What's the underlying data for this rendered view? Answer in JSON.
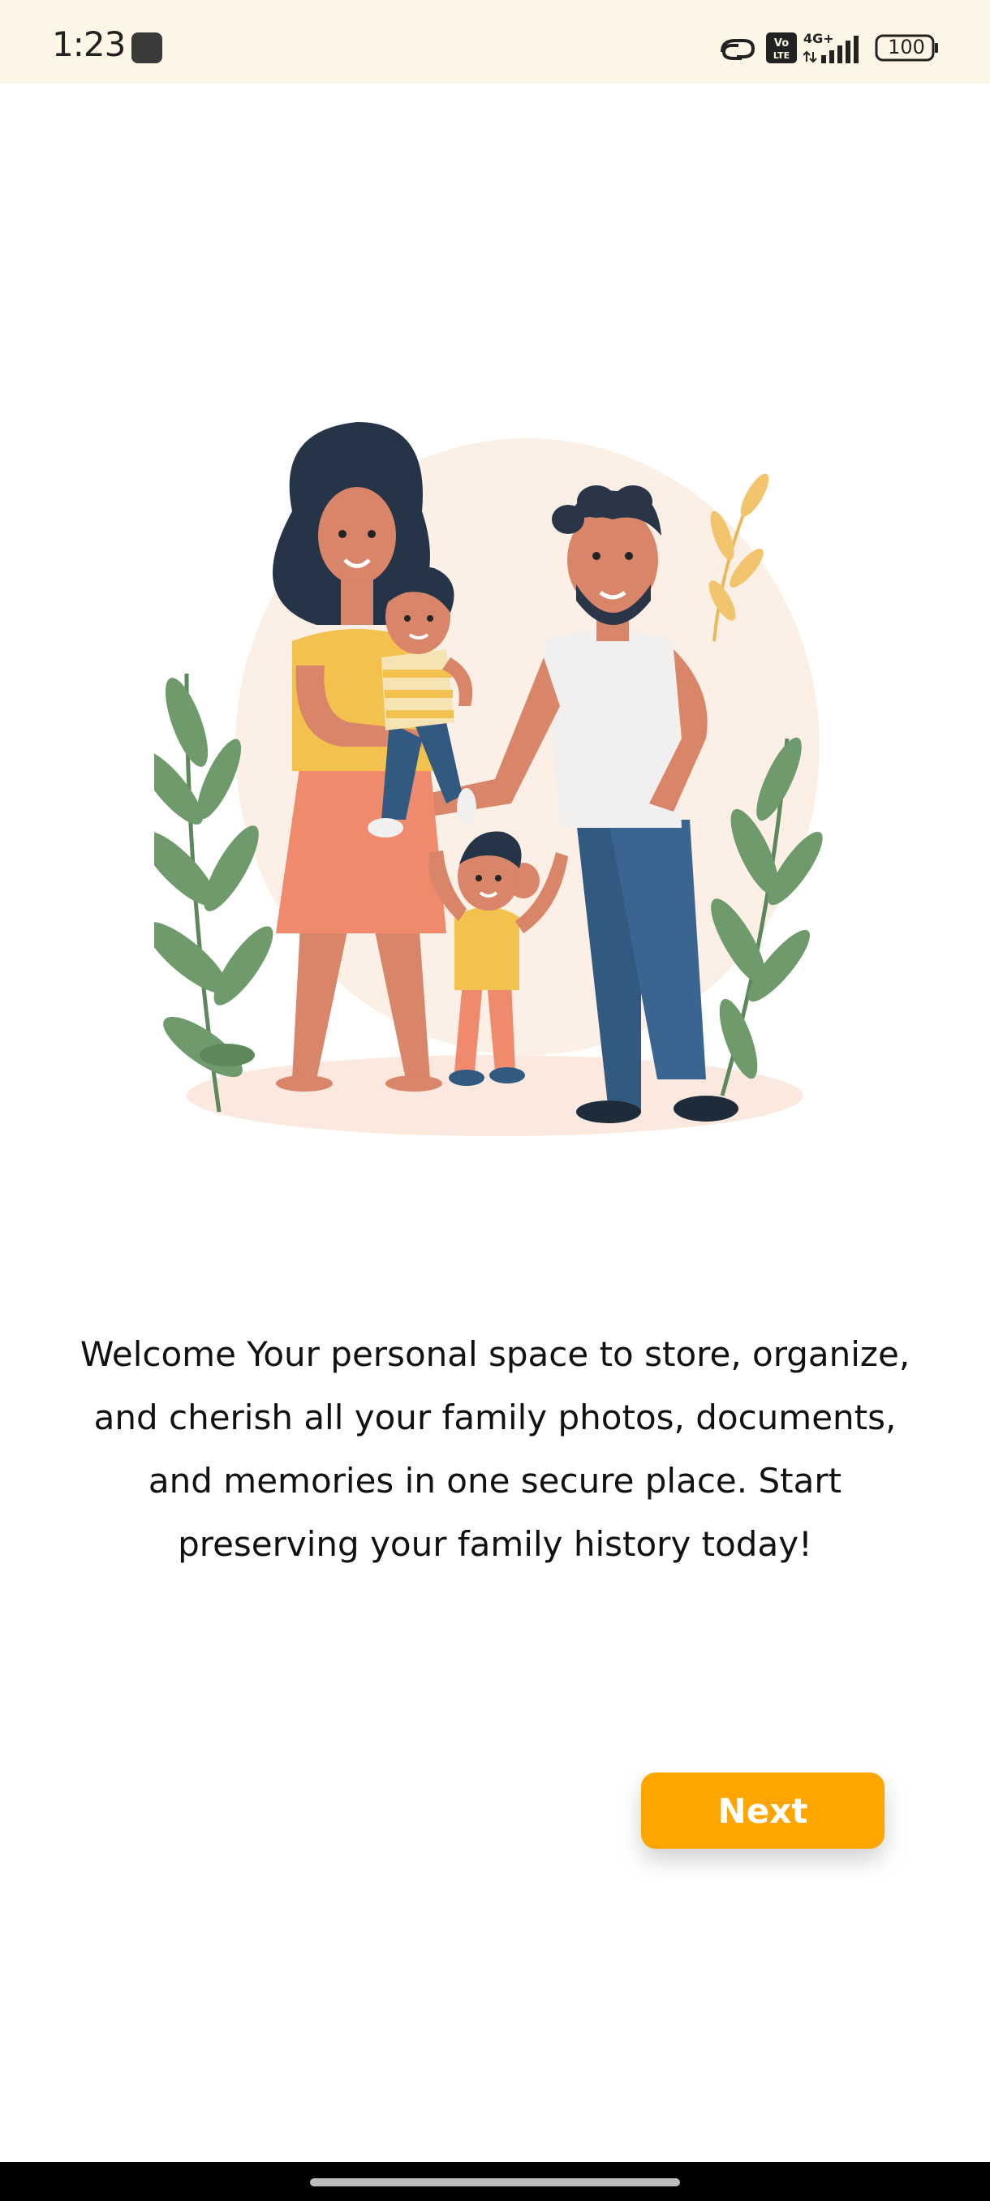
{
  "status_bar": {
    "time": "1:23",
    "battery": "100",
    "icons": [
      "link-icon",
      "volte-icon",
      "4g-signal-icon",
      "battery-icon"
    ]
  },
  "onboarding": {
    "illustration": "family-illustration",
    "welcome_text": "Welcome Your personal space to store, organize, and cherish all your family photos, documents, and memories in one secure place. Start preserving your family history today!",
    "next_label": "Next"
  },
  "colors": {
    "status_bar_bg": "#fdf5e6",
    "accent": "#ffa500",
    "text": "#111111"
  }
}
